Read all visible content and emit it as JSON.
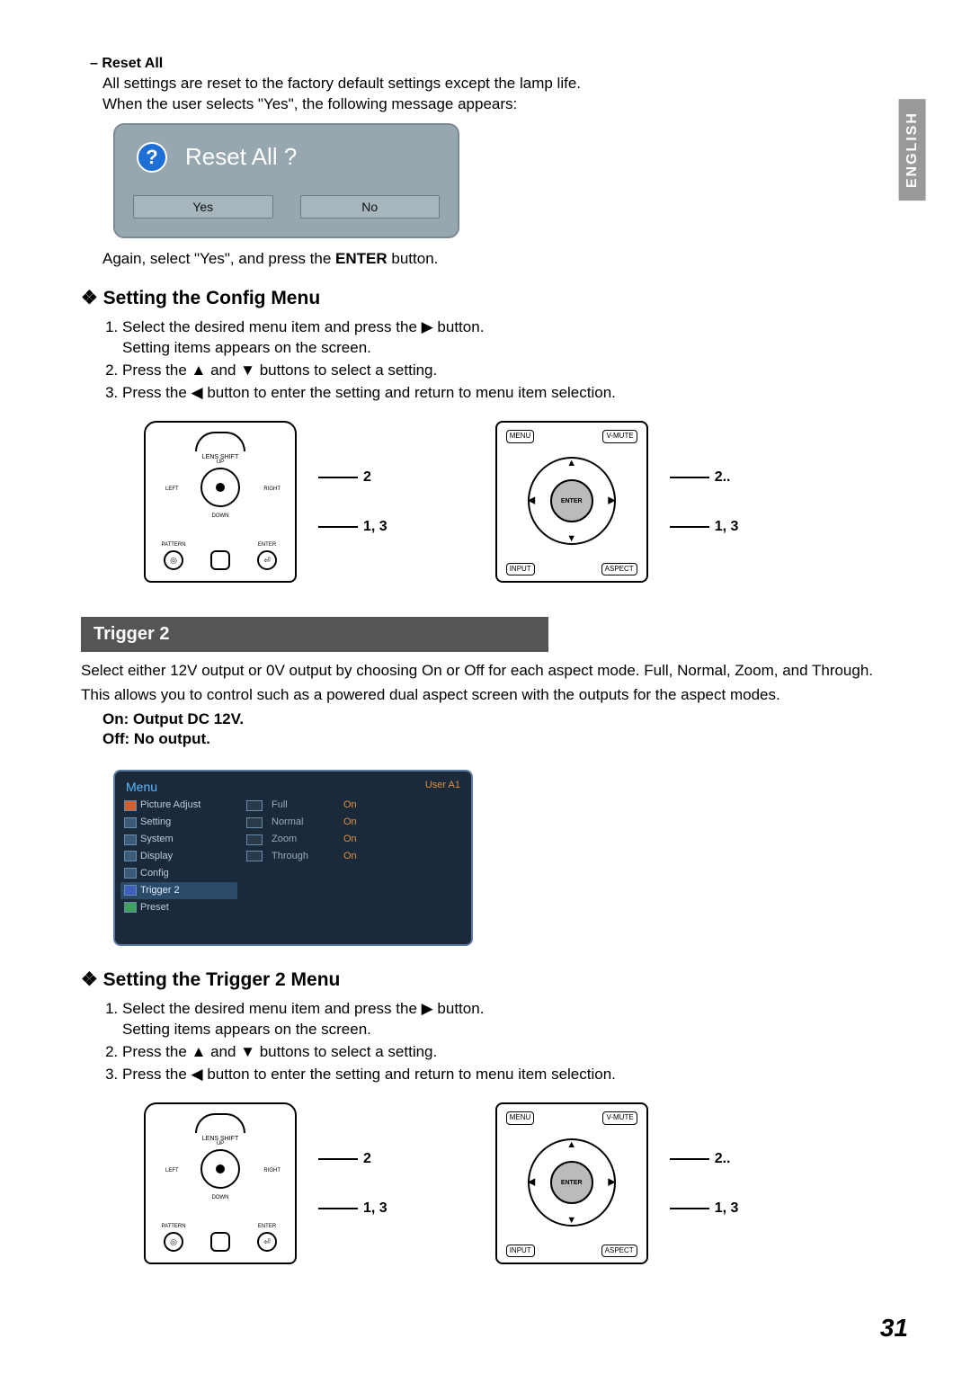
{
  "language_tab": "ENGLISH",
  "reset_all": {
    "heading": "– Reset All",
    "desc1": "All settings are reset to the factory default settings except the lamp life.",
    "desc2": "When the user selects \"Yes\", the following message appears:",
    "dialog_title": "Reset All ?",
    "yes": "Yes",
    "no": "No",
    "after": "Again, select \"Yes\", and press the ",
    "after_bold": "ENTER",
    "after2": " button."
  },
  "config": {
    "heading": "Setting the Config Menu",
    "step1a": "Select the desired menu item and press the ▶ button.",
    "step1b": "Setting items appears on the screen.",
    "step2": "Press the ▲ and ▼ buttons to select a setting.",
    "step3": "Press the ◀ button to enter the setting and return to menu item selection."
  },
  "callouts": {
    "a": "2",
    "b": "1, 3",
    "a2": "2.",
    "b2": "1, 3"
  },
  "top_panel_labels": {
    "lens_shift": "LENS SHIFT",
    "up": "UP",
    "down": "DOWN",
    "left": "LEFT",
    "right": "RIGHT",
    "pattern": "PATTERN",
    "enter": "ENTER"
  },
  "remote_labels": {
    "menu": "MENU",
    "vmute": "V-MUTE",
    "enter": "ENTER",
    "input": "INPUT",
    "aspect": "ASPECT"
  },
  "trigger": {
    "bar": "Trigger 2",
    "desc1": "Select either 12V output or 0V output by choosing On or Off for each aspect mode. Full, Normal, Zoom, and Through.",
    "desc2": "This allows you to control such as a powered dual aspect screen with the outputs for the aspect modes.",
    "on": "On:  Output DC 12V.",
    "off": "Off:  No output."
  },
  "osd": {
    "menu": "Menu",
    "user": "User A1",
    "left_items": [
      "Picture Adjust",
      "Setting",
      "System",
      "Display",
      "Config",
      "Trigger 2",
      "Preset"
    ],
    "right_rows": [
      {
        "label": "Full",
        "val": "On"
      },
      {
        "label": "Normal",
        "val": "On"
      },
      {
        "label": "Zoom",
        "val": "On"
      },
      {
        "label": "Through",
        "val": "On"
      }
    ]
  },
  "trigger_menu": {
    "heading": "Setting the Trigger 2 Menu",
    "step1a": "Select the desired menu item and press the ▶ button.",
    "step1b": "Setting items appears on the screen.",
    "step2": "Press the ▲ and ▼ buttons to select a setting.",
    "step3": "Press the ◀ button to enter the setting and return to menu item selection."
  },
  "page_number": "31"
}
